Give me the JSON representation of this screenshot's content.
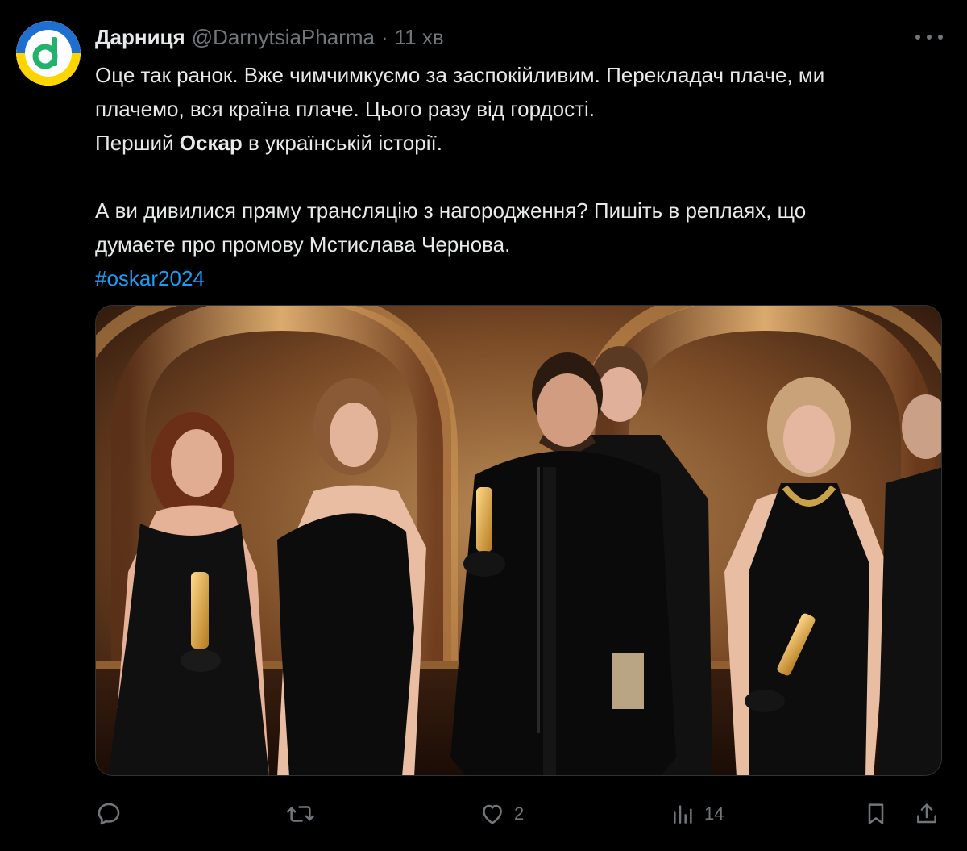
{
  "author": {
    "name": "Дарниця",
    "handle": "@DarnytsiaPharma",
    "separator": "·",
    "time": "11 хв",
    "avatar_icon": "darnytsia-logo-icon",
    "avatar_colors": {
      "blue": "#1f6fd0",
      "yellow": "#ffd500",
      "green": "#21b36b"
    }
  },
  "post": {
    "line1": "Оце так ранок. Вже чимчимкуємо за заспокійливим. Перекладач плаче, ми",
    "line2": "плачемо, вся країна плаче. Цього разу від гордості.",
    "line3_prefix": "Перший ",
    "line3_bold": "Оскар",
    "line3_suffix": " в українській історії.",
    "line4": "А ви дивилися пряму трансляцію з нагородження? Пишіть в реплаях, що",
    "line5": "думаєте про промову Мстислава Чернова.",
    "hashtag": "#oskar2024"
  },
  "media": {
    "type": "photo",
    "icon": "photo-oscars-stage"
  },
  "actions": {
    "reply": {
      "icon": "reply-icon",
      "count": ""
    },
    "repost": {
      "icon": "repost-icon",
      "count": ""
    },
    "like": {
      "icon": "heart-icon",
      "count": "2"
    },
    "views": {
      "icon": "views-icon",
      "count": "14"
    },
    "bookmark": {
      "icon": "bookmark-icon"
    },
    "share": {
      "icon": "share-icon"
    }
  },
  "colors": {
    "background": "#000000",
    "text": "#e7e9ea",
    "muted": "#71767b",
    "link": "#1d9bf0"
  }
}
